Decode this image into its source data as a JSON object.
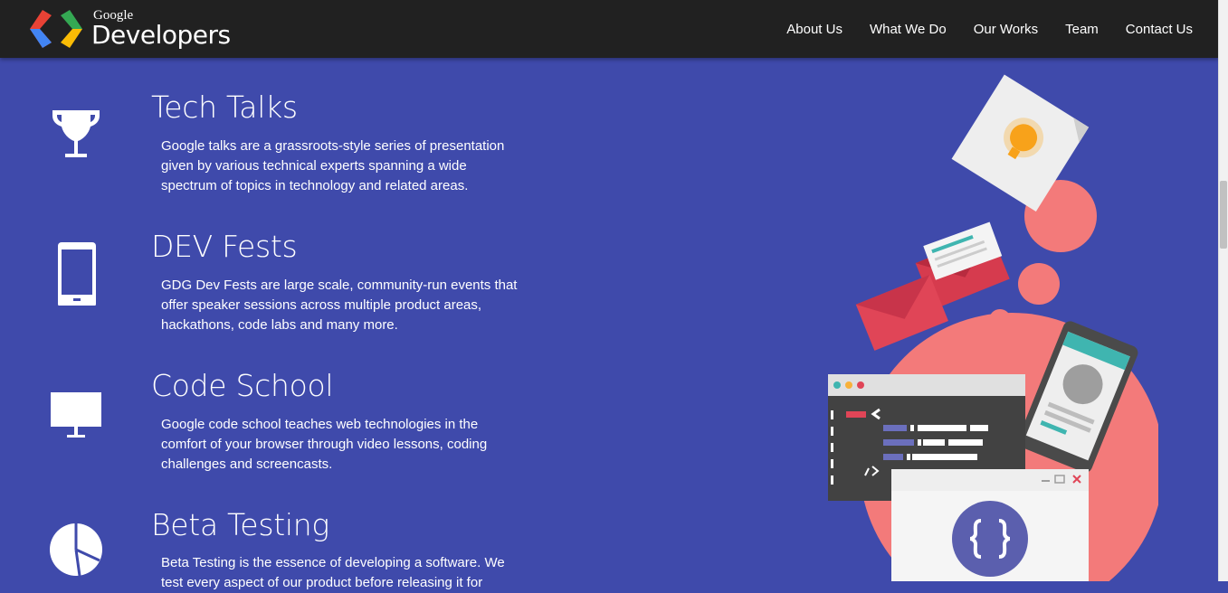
{
  "header": {
    "logo_small": "Google",
    "logo_big": "Developers",
    "nav": [
      "About Us",
      "What We Do",
      "Our Works",
      "Team",
      "Contact Us"
    ]
  },
  "features": [
    {
      "title": "Tech Talks",
      "description": "Google talks are a grassroots-style series of presentation given by various technical experts spanning a wide spectrum of topics in technology and related areas.",
      "icon": "trophy-icon"
    },
    {
      "title": "DEV Fests",
      "description": "GDG Dev Fests are large scale, community-run events that offer speaker sessions across multiple product areas, hackathons, code labs and many more.",
      "icon": "tablet-icon"
    },
    {
      "title": "Code School",
      "description": "Google code school teaches web technologies in the comfort of your browser through video lessons, coding challenges and screencasts.",
      "icon": "monitor-icon"
    },
    {
      "title": "Beta Testing",
      "description": "Beta Testing is the essence of developing a software. We test every aspect of our product before releasing it for",
      "icon": "pie-chart-icon"
    }
  ],
  "colors": {
    "background": "#3f4aab",
    "navbar": "#212121",
    "accent_coral": "#f37a7a",
    "accent_red": "#d63b4e"
  }
}
